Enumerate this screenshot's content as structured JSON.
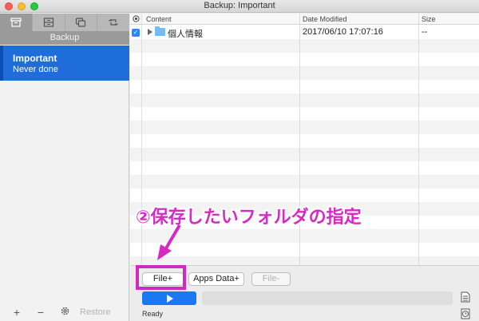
{
  "window": {
    "title": "Backup: Important"
  },
  "sidebar": {
    "mode_label": "Backup",
    "item": {
      "name": "Important",
      "status": "Never done"
    },
    "add_label": "+",
    "remove_label": "−",
    "restore_label": "Restore"
  },
  "table": {
    "columns": [
      "Content",
      "Date Modified",
      "Size"
    ],
    "rows": [
      {
        "name": "個人情報",
        "date": "2017/06/10 17:07:16",
        "size": "--",
        "checked": true
      }
    ]
  },
  "buttons": {
    "file_add": "File+",
    "apps_add": "Apps Data+",
    "file_remove": "File-"
  },
  "status": {
    "text": "Ready",
    "progress": 0
  },
  "annotation": {
    "text": "②保存したいフォルダの指定"
  },
  "colors": {
    "accent": "#1f6ddb",
    "annotation": "#d42bc3"
  }
}
